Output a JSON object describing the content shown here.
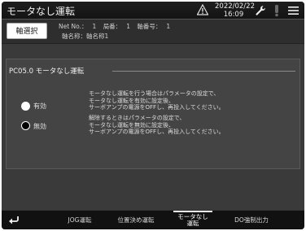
{
  "window": {
    "title": "モータなし運転",
    "date": "2022/02/22",
    "time": "16:09"
  },
  "info": {
    "axis_button": "軸選択",
    "net_no_label": "Net No.：",
    "net_no_value": "1",
    "station_label": "局番：",
    "station_value": "1",
    "axis_no_label": "軸番号：",
    "axis_no_value": "1",
    "axis_name": "軸名称：軸名称1"
  },
  "panel": {
    "title": "PC05.0 モータなし運転",
    "options": [
      {
        "label": "有効",
        "selected": false,
        "description": [
          "モータなし運転を行う場合はパラメータの設定で、",
          "モータなし運転を有効に設定後、",
          "サーボアンプの電源をOFFし、再投入してください。"
        ]
      },
      {
        "label": "無効",
        "selected": true,
        "description": [
          "解除するときはパラメータの設定で、",
          "モータなし運転を無効に設定後、",
          "サーボアンプの電源をOFFし、再投入してください。"
        ]
      }
    ]
  },
  "bottom_tabs": [
    {
      "label": "JOG運転",
      "active": false
    },
    {
      "label": "位置決め運転",
      "active": false
    },
    {
      "label": "モータなし\n運転",
      "active": true
    },
    {
      "label": "DO強制出力",
      "active": false
    }
  ],
  "icons": {
    "warning": "warning-icon",
    "settings": "wrench-icon",
    "alarm": "alarm-icon",
    "menu": "menu-icon",
    "back": "back-icon"
  }
}
